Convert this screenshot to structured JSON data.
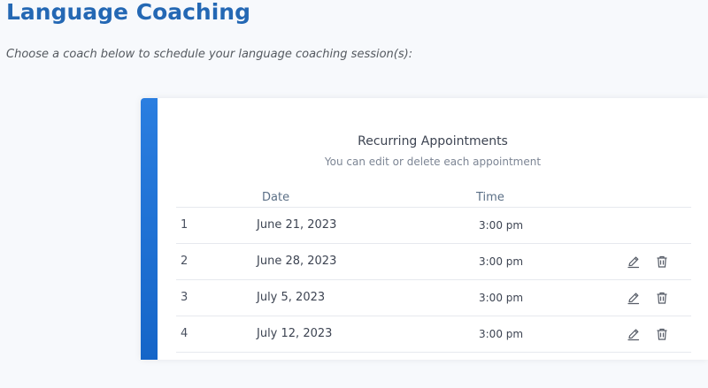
{
  "page": {
    "title": "Language Coaching",
    "subtitle": "Choose a coach below to schedule your language coaching session(s):"
  },
  "panel": {
    "heading": "Recurring Appointments",
    "subheading": "You can edit or delete each appointment",
    "columns": {
      "date": "Date",
      "time": "Time"
    },
    "accent_color": "#1a6fd4",
    "rows": [
      {
        "num": "1",
        "date": "June 21, 2023",
        "time": "3:00 pm",
        "actions": false
      },
      {
        "num": "2",
        "date": "June 28, 2023",
        "time": "3:00 pm",
        "actions": true,
        "edit_icon": "pencil-icon",
        "delete_icon": "trash-icon"
      },
      {
        "num": "3",
        "date": "July 5, 2023",
        "time": "3:00 pm",
        "actions": true,
        "edit_icon": "pencil-icon",
        "delete_icon": "trash-icon"
      },
      {
        "num": "4",
        "date": "July 12, 2023",
        "time": "3:00 pm",
        "actions": true,
        "edit_icon": "pencil-icon",
        "delete_icon": "trash-icon"
      }
    ]
  }
}
